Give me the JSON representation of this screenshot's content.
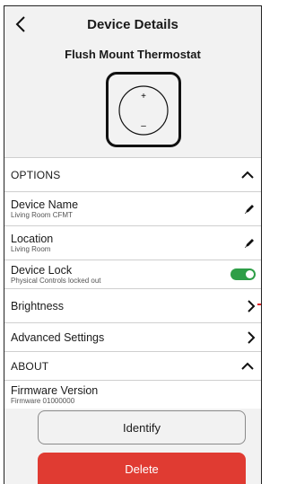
{
  "header": {
    "title": "Device Details",
    "device_name": "Flush Mount Thermostat",
    "dial_plus": "+",
    "dial_minus": "–"
  },
  "options": {
    "label": "OPTIONS",
    "device_name": {
      "label": "Device Name",
      "value": "Living Room CFMT"
    },
    "location": {
      "label": "Location",
      "value": "Living Room"
    },
    "device_lock": {
      "label": "Device Lock",
      "value": "Physical Controls locked out",
      "enabled": true
    },
    "brightness": {
      "label": "Brightness"
    },
    "advanced": {
      "label": "Advanced Settings"
    }
  },
  "about": {
    "label": "ABOUT",
    "firmware": {
      "label": "Firmware Version",
      "value": "Firmware 01000000"
    }
  },
  "actions": {
    "identify_label": "Identify",
    "delete_label": "Delete"
  },
  "colors": {
    "toggle_on": "#2e9e47",
    "delete": "#e03b32",
    "background": "#f2f2f2"
  },
  "icons": [
    "back-icon",
    "chevron-up-icon",
    "pencil-icon",
    "chevron-right-icon",
    "toggle-switch"
  ]
}
